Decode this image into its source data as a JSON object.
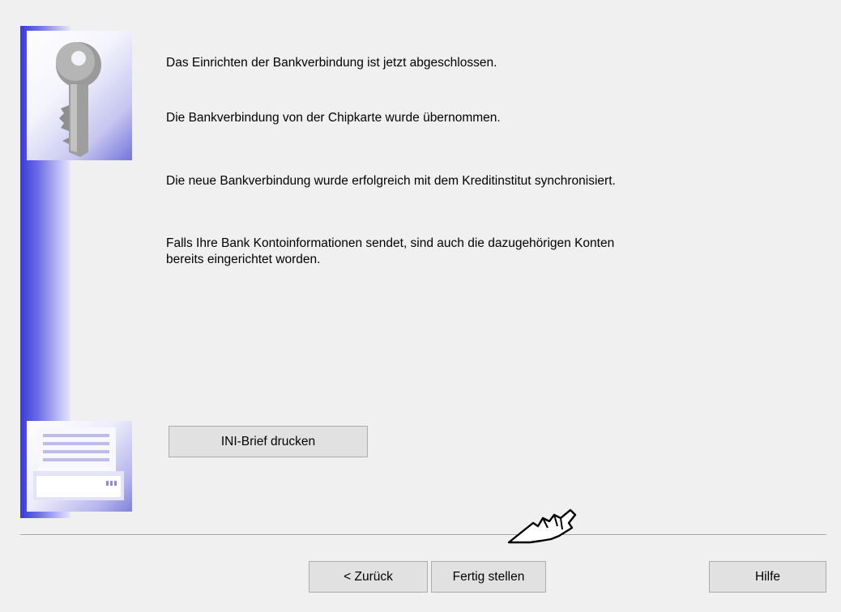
{
  "content": {
    "line1": "Das Einrichten der Bankverbindung ist jetzt abgeschlossen.",
    "line2": "Die Bankverbindung von der Chipkarte wurde übernommen.",
    "line3": "Die neue Bankverbindung wurde erfolgreich mit dem Kreditinstitut synchronisiert.",
    "line4a": "Falls Ihre Bank Kontoinformationen sendet, sind auch die dazugehörigen Konten",
    "line4b": "bereits eingerichtet worden."
  },
  "buttons": {
    "ini_letter": "INI-Brief drucken",
    "back": "< Zurück",
    "finish": "Fertig stellen",
    "help": "Hilfe"
  },
  "icons": {
    "key": "key-icon",
    "printer": "printer-icon",
    "cursor": "hand-pointer-icon"
  },
  "colors": {
    "background": "#f0f0f0",
    "accent": "#3a3ad8",
    "button": "#e1e1e1"
  }
}
